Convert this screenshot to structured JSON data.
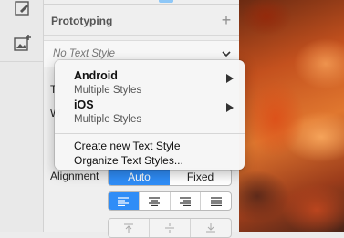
{
  "inspector": {
    "section_title": "Prototyping",
    "text_style_value": "No Text Style",
    "row_label_1": "T",
    "row_label_2": "W",
    "alignment_label": "Alignment",
    "sizing_options": [
      "Auto",
      "Fixed"
    ],
    "sizing_selected": "Auto",
    "text_alignments": [
      "left-align-icon",
      "center-align-icon",
      "right-align-icon",
      "justify-icon"
    ],
    "text_alignment_selected": "left-align-icon",
    "vertical_alignments": [
      "top-icon",
      "middle-icon",
      "bottom-icon"
    ]
  },
  "menu": {
    "items": [
      {
        "title": "Android",
        "subtitle": "Multiple Styles",
        "has_submenu": true
      },
      {
        "title": "iOS",
        "subtitle": "Multiple Styles",
        "has_submenu": true
      }
    ],
    "commands": [
      "Create new Text Style",
      "Organize Text Styles..."
    ]
  },
  "colors": {
    "accent": "#2f8df7",
    "panel_bg": "#efefef"
  }
}
